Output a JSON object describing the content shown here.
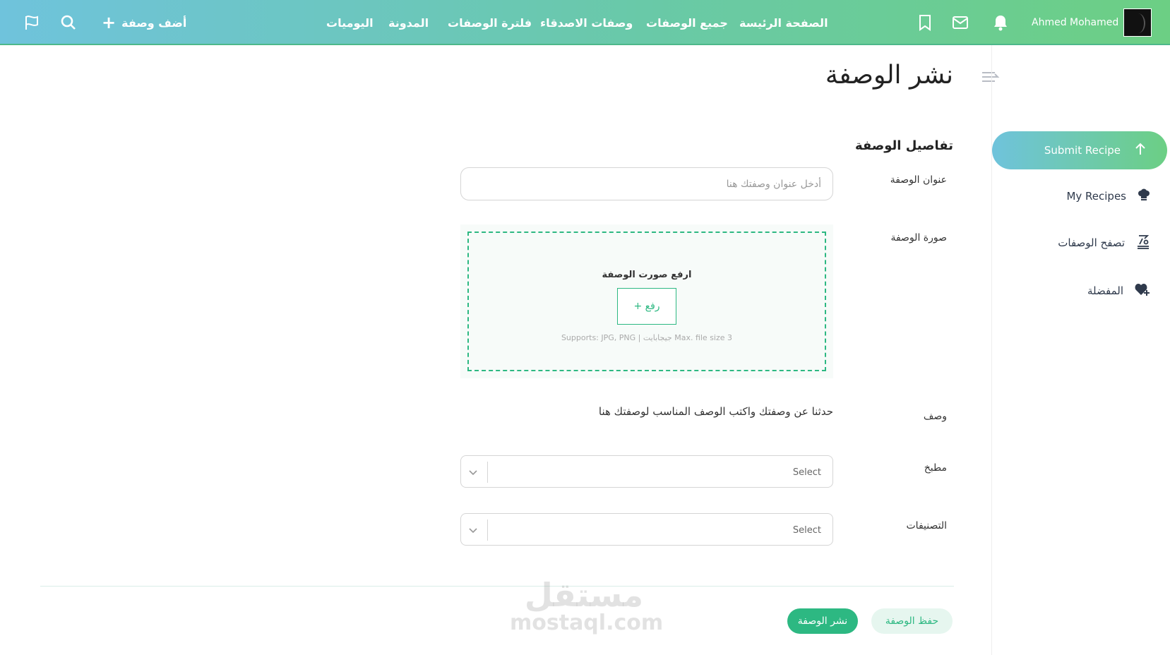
{
  "header": {
    "user_name": "Ahmed Mohamed",
    "nav": [
      "الصفحة الرئيسة",
      "جميع الوصفات",
      "وصفات الاصدقاء",
      "فلترة الوصفات",
      "المدونة",
      "اليوميات"
    ],
    "add_recipe": "أضف وصفة",
    "icons": [
      "bookmark-icon",
      "mail-icon",
      "bell-icon",
      "search-icon",
      "flag-icon",
      "plus-icon"
    ]
  },
  "sidebar": {
    "items": [
      {
        "label": "Submit Recipe",
        "icon": "arrow-up-icon",
        "active": true
      },
      {
        "label": "My Recipes",
        "icon": "chef-hat-icon"
      },
      {
        "label": "تصفح الوصفات",
        "icon": "recipe-browse-icon"
      },
      {
        "label": "المفضلة",
        "icon": "heart-plus-icon"
      }
    ]
  },
  "page": {
    "title": "نشر الوصفة",
    "section_title": "تفاصيل الوصفة"
  },
  "form": {
    "title_label": "عنوان الوصفة",
    "title_placeholder": "أدخل عنوان وصفتك هنا",
    "image_label": "صورة الوصفة",
    "upload_title": "ارفع صورت الوصفة",
    "upload_button": "+ رفع",
    "upload_hint": "Supports: JPG, PNG | جيجابايت Max. file size 3",
    "description_label": "وصف",
    "description_text": "حدثنا عن وصفتك واكتب الوصف المناسب لوصفتك هنا",
    "cuisine_label": "مطبخ",
    "cuisine_value": "Select",
    "categories_label": "التصنيفات",
    "categories_value": "Select"
  },
  "actions": {
    "publish": "نشر الوصفة",
    "save": "حفظ الوصفة"
  },
  "watermark": {
    "arabic": "مستقل",
    "latin": "mostaql.com"
  },
  "colors": {
    "accent_green": "#2db882",
    "gradient_start": "#6fc3dc",
    "gradient_end": "#6ccf84"
  }
}
